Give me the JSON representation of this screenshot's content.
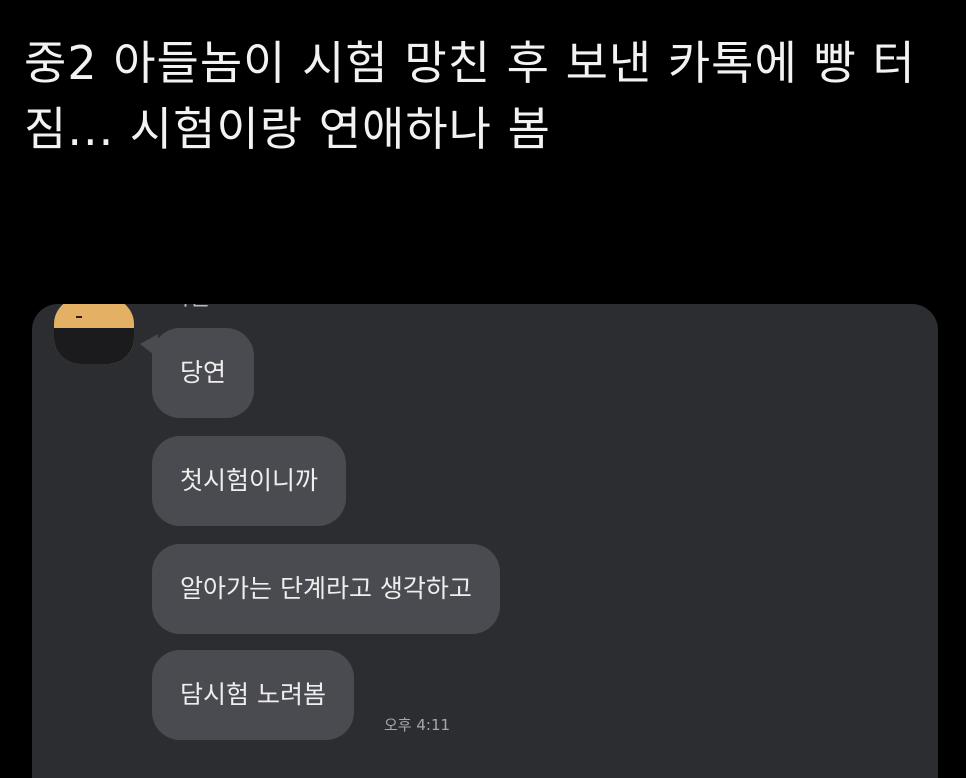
{
  "post": {
    "title": "중2 아들놈이 시험 망친 후 보낸 카톡에 빵 터짐... 시험이랑 연애하나 봄"
  },
  "chat": {
    "sender_name": "아들",
    "messages": [
      {
        "text": "당연"
      },
      {
        "text": "첫시험이니까"
      },
      {
        "text": "알아가는 단계라고 생각하고"
      },
      {
        "text": "담시험 노려봄"
      }
    ],
    "timestamp": "오후 4:11"
  },
  "colors": {
    "background": "#000000",
    "panel": "#2c2d31",
    "bubble": "#4a4b50",
    "avatar": "#e4b063"
  }
}
